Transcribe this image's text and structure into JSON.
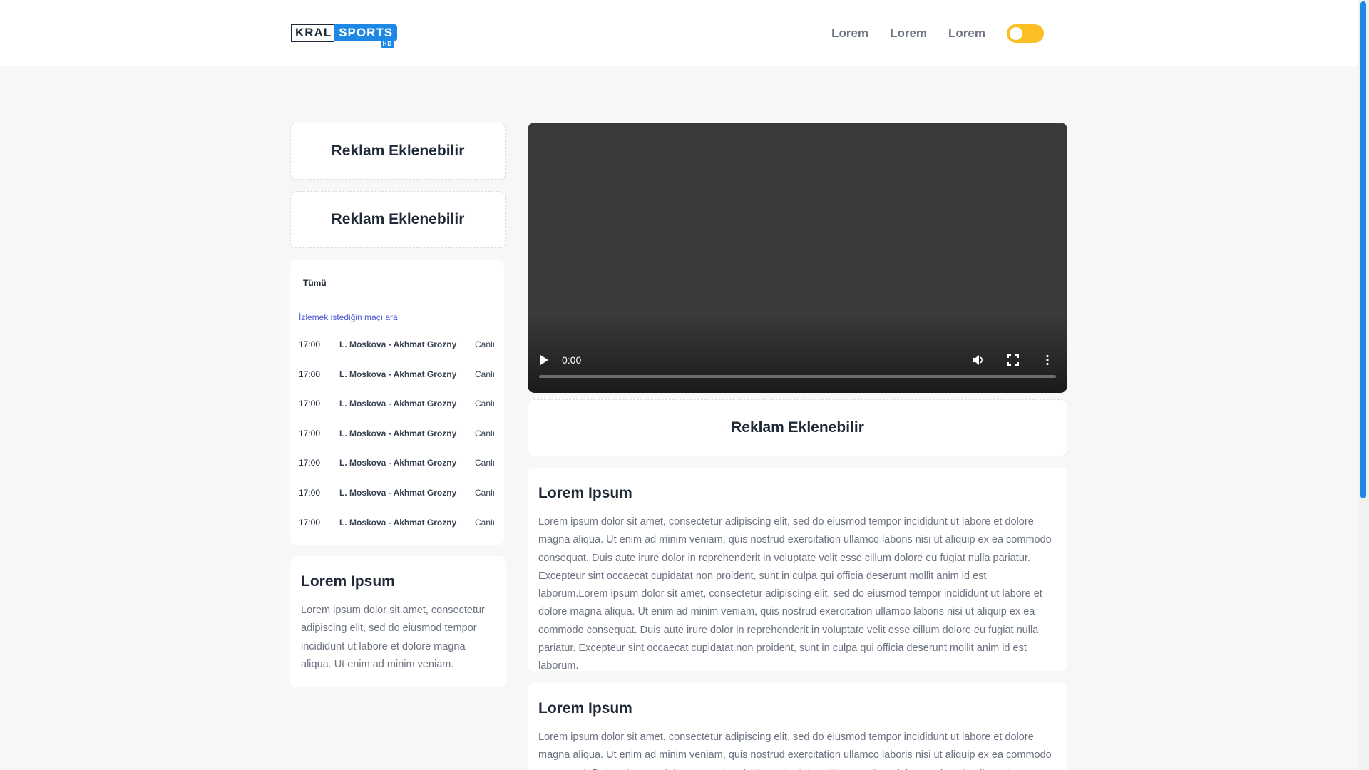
{
  "header": {
    "logo": {
      "word1": "KRAL",
      "word2": "SPORTS",
      "badge": "HD"
    },
    "nav": [
      "Lorem",
      "Lorem",
      "Lorem"
    ],
    "theme_toggle_state": "off"
  },
  "ads": {
    "left_top": "Reklam Eklenebilir",
    "left_second": "Reklam Eklenebilir",
    "under_video": "Reklam Eklenebilir"
  },
  "matches": {
    "filter_tab": "Tümü",
    "search_placeholder": "İzlemek istediğin maçı ara",
    "rows": [
      {
        "time": "17:00",
        "teams": "L. Moskova - Akhmat Grozny",
        "status": "Canlı"
      },
      {
        "time": "17:00",
        "teams": "L. Moskova - Akhmat Grozny",
        "status": "Canlı"
      },
      {
        "time": "17:00",
        "teams": "L. Moskova - Akhmat Grozny",
        "status": "Canlı"
      },
      {
        "time": "17:00",
        "teams": "L. Moskova - Akhmat Grozny",
        "status": "Canlı"
      },
      {
        "time": "17:00",
        "teams": "L. Moskova - Akhmat Grozny",
        "status": "Canlı"
      },
      {
        "time": "17:00",
        "teams": "L. Moskova - Akhmat Grozny",
        "status": "Canlı"
      },
      {
        "time": "17:00",
        "teams": "L. Moskova - Akhmat Grozny",
        "status": "Canlı"
      }
    ]
  },
  "sidebar_text": {
    "title": "Lorem Ipsum",
    "body": "Lorem ipsum dolor sit amet, consectetur adipiscing elit, sed do eiusmod tempor incididunt ut labore et dolore magna aliqua. Ut enim ad minim veniam."
  },
  "video": {
    "current_time": "0:00",
    "progress": 0
  },
  "articles": [
    {
      "title": "Lorem Ipsum",
      "body": "Lorem ipsum dolor sit amet, consectetur adipiscing elit, sed do eiusmod tempor incididunt ut labore et dolore magna aliqua. Ut enim ad minim veniam, quis nostrud exercitation ullamco laboris nisi ut aliquip ex ea commodo consequat. Duis aute irure dolor in reprehenderit in voluptate velit esse cillum dolore eu fugiat nulla pariatur. Excepteur sint occaecat cupidatat non proident, sunt in culpa qui officia deserunt mollit anim id est laborum.Lorem ipsum dolor sit amet, consectetur adipiscing elit, sed do eiusmod tempor incididunt ut labore et dolore magna aliqua. Ut enim ad minim veniam, quis nostrud exercitation ullamco laboris nisi ut aliquip ex ea commodo consequat. Duis aute irure dolor in reprehenderit in voluptate velit esse cillum dolore eu fugiat nulla pariatur. Excepteur sint occaecat cupidatat non proident, sunt in culpa qui officia deserunt mollit anim id est laborum."
    },
    {
      "title": "Lorem Ipsum",
      "body": "Lorem ipsum dolor sit amet, consectetur adipiscing elit, sed do eiusmod tempor incididunt ut labore et dolore magna aliqua. Ut enim ad minim veniam, quis nostrud exercitation ullamco laboris nisi ut aliquip ex ea commodo consequat. Duis aute irure dolor in reprehenderit in voluptate velit esse cillum dolore eu fugiat nulla pariatur."
    }
  ],
  "colors": {
    "accent": "#1e88e5",
    "toggle": "#fbbf24",
    "page_bg": "#f7f7f7",
    "card_bg": "#ffffff"
  },
  "icons": [
    "play-icon",
    "volume-icon",
    "fullscreen-icon",
    "more-vertical-icon"
  ]
}
